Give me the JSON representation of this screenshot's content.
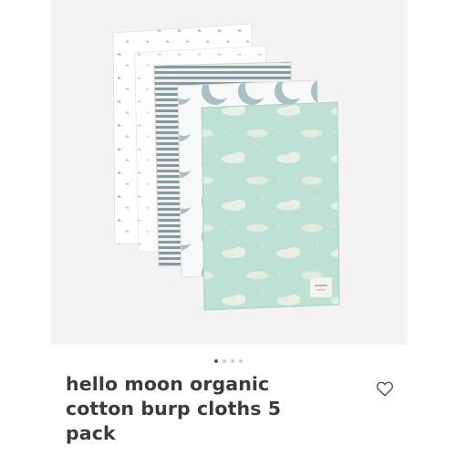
{
  "product": {
    "title": "hello moon organic cotton burp cloths 5 pack",
    "image_icon": "burp-cloths-product-photo"
  },
  "carousel": {
    "total_images": 4,
    "active_index": 0
  },
  "actions": {
    "wishlist_icon": "heart-outline-icon"
  },
  "colors": {
    "image_background": "#f3f3f3",
    "title_text": "#3b3b3b",
    "mint_cloth": "#bfe0d4",
    "stripe_gray": "#8a979d",
    "active_dot": "#5a5a5a",
    "inactive_dot": "#cfcfcf"
  }
}
